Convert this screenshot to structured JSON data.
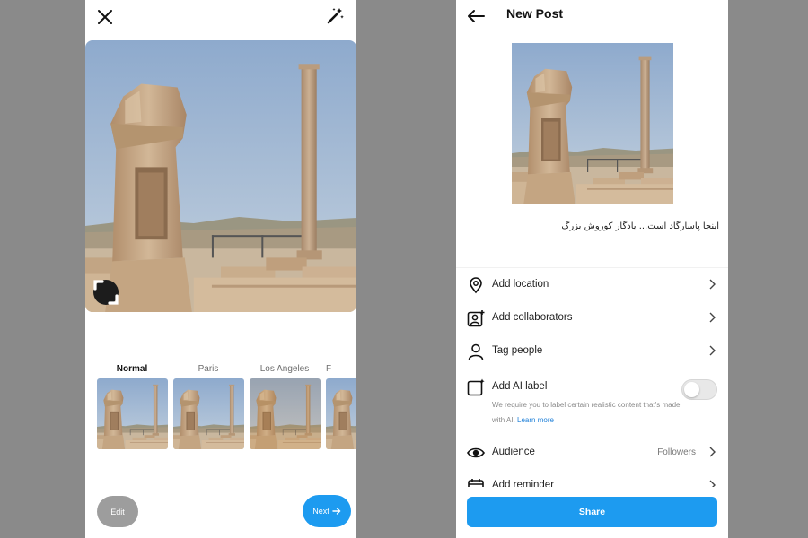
{
  "colors": {
    "accent": "#1d9bf0",
    "sky": "#9bb3cf",
    "stone": "#c7a886"
  },
  "left_screen": {
    "icons": {
      "close": "close-icon",
      "magic": "magic-wand-icon",
      "expand": "expand-icon"
    },
    "filters": [
      {
        "label": "Normal",
        "selected": true
      },
      {
        "label": "Paris",
        "selected": false
      },
      {
        "label": "Los Angeles",
        "selected": false
      },
      {
        "label": "F",
        "selected": false
      }
    ],
    "edit_label": "Edit",
    "next_label": "Next"
  },
  "right_screen": {
    "title": "New Post",
    "caption": "اینجا پاسارگاد است... یادگار کوروش بزرگ",
    "rows": {
      "location": "Add location",
      "collaborators": "Add collaborators",
      "tag_people": "Tag people",
      "ai_label": "Add AI label",
      "audience": "Audience",
      "reminder": "Add reminder"
    },
    "ai_desc": "We require you to label certain realistic content that's made with AI.",
    "ai_learn": "Learn more",
    "ai_toggle_on": false,
    "audience_value": "Followers",
    "share_label": "Share"
  }
}
